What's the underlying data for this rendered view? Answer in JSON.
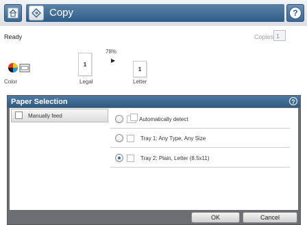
{
  "header": {
    "title": "Copy",
    "home_icon": "home-icon",
    "app_icon": "copy-icon",
    "help_icon": "help-icon",
    "help_glyph": "?"
  },
  "status": {
    "text": "Ready",
    "copies_label": "Copies:",
    "copies_value": "1"
  },
  "preview": {
    "color_label": "Color",
    "zoom": "78%",
    "source_size": "Legal",
    "output_size": "Letter",
    "page_number": "1"
  },
  "dialog": {
    "title": "Paper Selection",
    "help_glyph": "?",
    "manual_feed_label": "Manually feed",
    "options": [
      {
        "label": "Automatically detect",
        "selected": false
      },
      {
        "label": "Tray 1: Any Type, Any Size",
        "selected": false
      },
      {
        "label": "Tray 2: Plain, Letter (8.5x11)",
        "selected": true
      }
    ],
    "ok_label": "OK",
    "cancel_label": "Cancel"
  },
  "colors": {
    "title_bar": "#2f5d87",
    "dialog_header": "#2d5a84",
    "radio_selected": "#2f6fb3"
  }
}
